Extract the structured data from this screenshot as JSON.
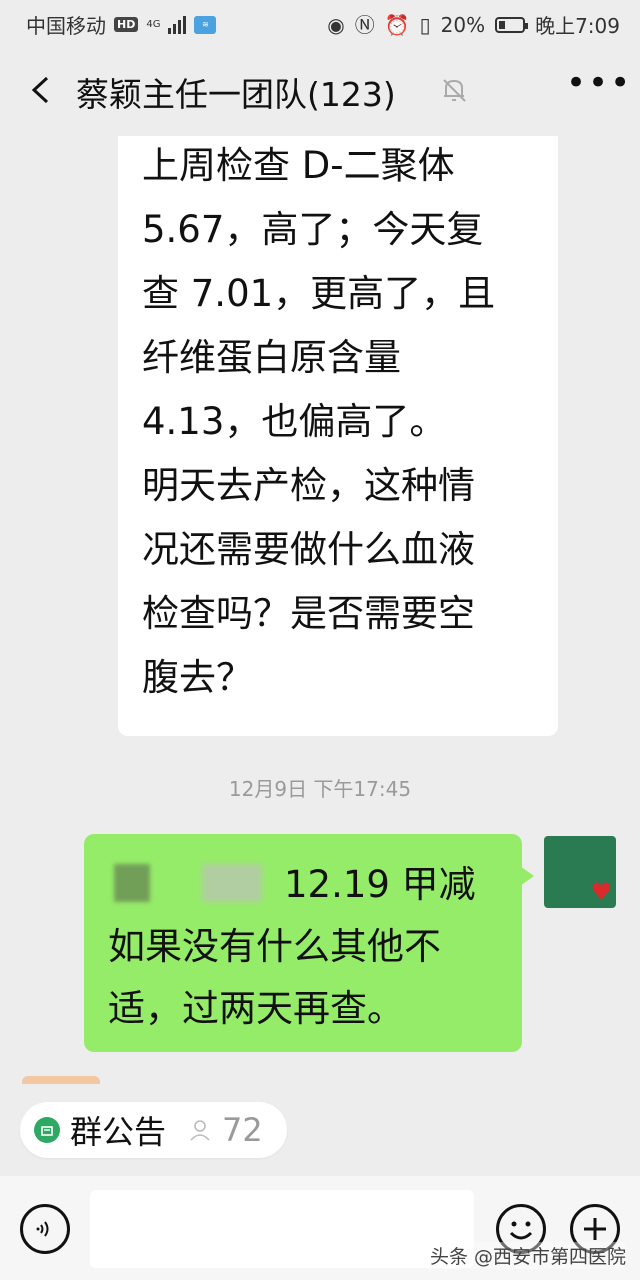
{
  "status_bar": {
    "carrier": "中国移动",
    "hd": "HD",
    "network": "4G",
    "battery": "20%",
    "time": "晚上7:09"
  },
  "header": {
    "title": "蔡颖主任一团队(123)"
  },
  "messages": [
    {
      "side": "left",
      "text": "上周检查 D-二聚体\n5.67，高了；今天复\n查 7.01，更高了，且\n纤维蛋白原含量\n4.13，也偏高了。\n明天去产检，这种情\n况还需要做什么血液\n检查吗？是否需要空\n腹去？"
    },
    {
      "type": "timestamp",
      "text": "12月9日 下午17:45"
    },
    {
      "side": "right",
      "text": "12.19 甲减\n如果没有什么其他不\n适，过两天再查。"
    }
  ],
  "announcement": {
    "label": "群公告",
    "count": "72"
  },
  "watermark": "头条 @西安市第四医院",
  "colors": {
    "background": "#ededed",
    "self_bubble": "#95ec69",
    "other_bubble": "#ffffff",
    "accent_green": "#2ea862"
  }
}
